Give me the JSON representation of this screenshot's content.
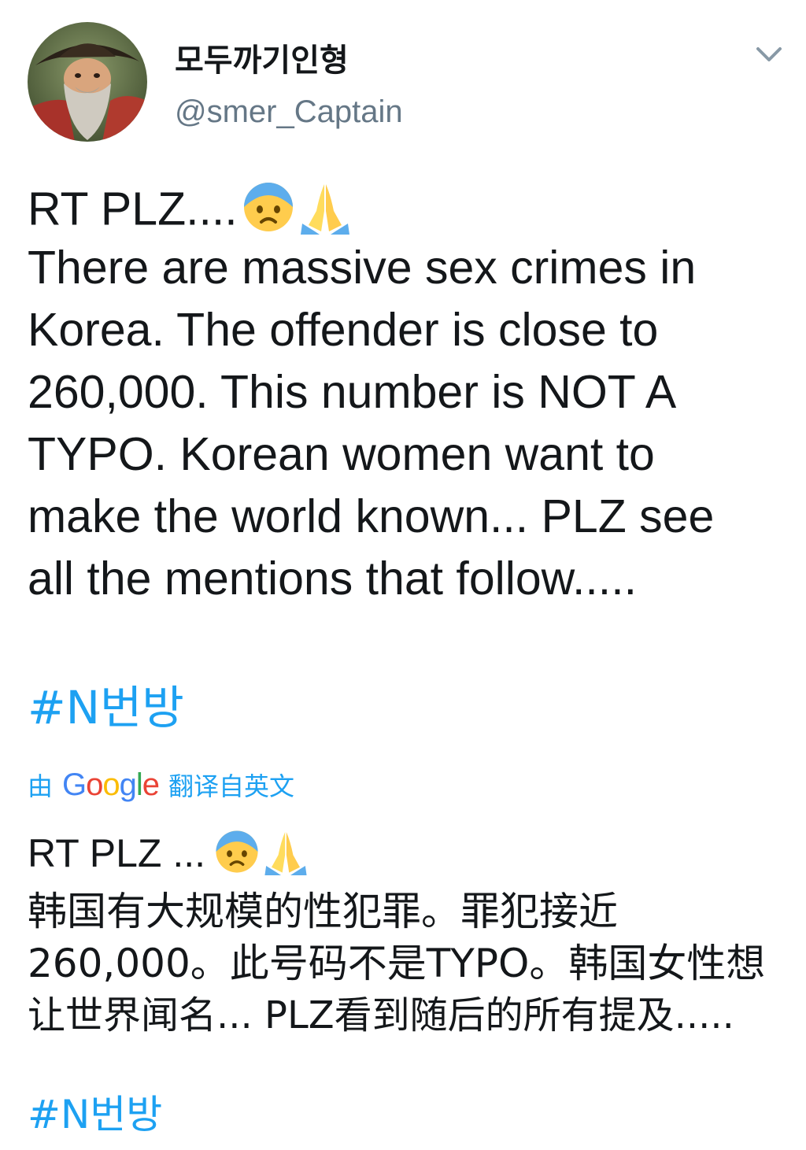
{
  "author": {
    "display_name": "모두까기인형",
    "handle": "@smer_Captain",
    "avatar_icon": "pirate-avatar"
  },
  "menu_icon": "chevron-down-icon",
  "tweet": {
    "en_line1_text": "RT PLZ....",
    "en_emojis": [
      "anxious-face-icon",
      "folded-hands-icon"
    ],
    "en_lines": [
      "There are massive sex crimes in",
      "Korea. The offender is close to",
      "260,000. This number is NOT A",
      "TYPO. Korean women want to",
      "make the world known... PLZ see",
      "all the mentions that follow....."
    ],
    "hashtag": "#N번방"
  },
  "translation": {
    "by_label": "由",
    "google_letters": [
      "G",
      "o",
      "o",
      "g",
      "l",
      "e"
    ],
    "google_colors": [
      "#4285f4",
      "#ea4335",
      "#fbbc05",
      "#4285f4",
      "#34a853",
      "#ea4335"
    ],
    "label": "翻译自英文",
    "cn_line1_text": "RT PLZ ...",
    "cn_lines": [
      "韩国有大规模的性犯罪。罪犯接近",
      "260,000。此号码不是TYPO。韩国女性想",
      "让世界闻名... PLZ看到随后的所有提及....."
    ],
    "hashtag": "#N번방"
  },
  "colors": {
    "link": "#1da1f2",
    "text": "#14171a",
    "secondary": "#657786"
  }
}
